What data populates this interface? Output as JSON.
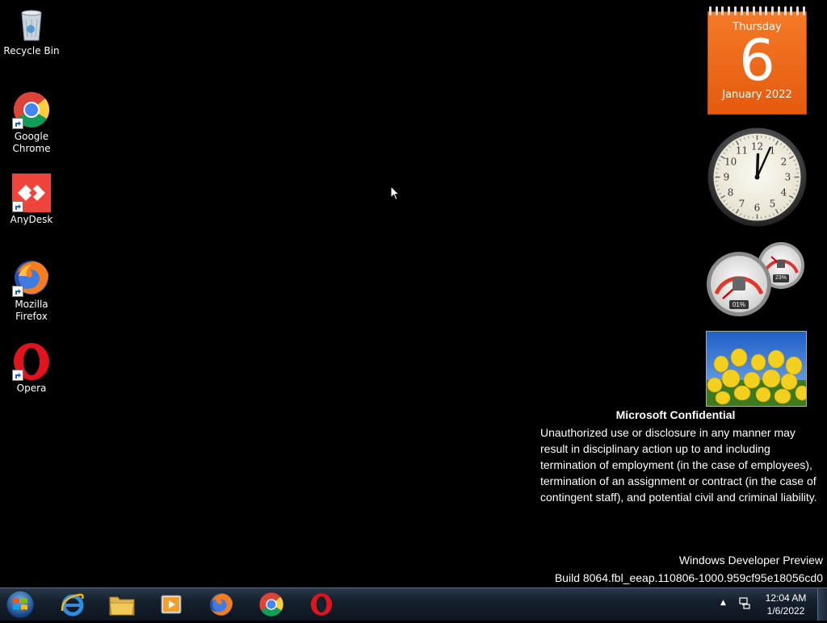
{
  "desktop": {
    "icons": [
      {
        "label_line1": "Recycle Bin",
        "label_line2": "",
        "icon": "recycle-bin-icon"
      },
      {
        "label_line1": "Google",
        "label_line2": "Chrome",
        "icon": "chrome-icon"
      },
      {
        "label_line1": "AnyDesk",
        "label_line2": "",
        "icon": "anydesk-icon"
      },
      {
        "label_line1": "Mozilla",
        "label_line2": "Firefox",
        "icon": "firefox-icon"
      },
      {
        "label_line1": "Opera",
        "label_line2": "",
        "icon": "opera-icon"
      }
    ]
  },
  "gadgets": {
    "calendar": {
      "weekday": "Thursday",
      "day": "6",
      "month_year": "January 2022",
      "color": "#f07020"
    },
    "clock": {
      "numbers": [
        "12",
        "1",
        "2",
        "3",
        "4",
        "5",
        "6",
        "7",
        "8",
        "9",
        "10",
        "11"
      ],
      "hour": 12,
      "minute": 4
    },
    "cpu_meter": {
      "cpu": "01%",
      "memory": "23%"
    },
    "slideshow": {
      "subject": "yellow tulips"
    }
  },
  "watermark": {
    "title": "Microsoft Confidential",
    "body": "Unauthorized use or disclosure in any manner may result in disciplinary action up to and including termination of employment (in the case of employees), termination of an assignment or contract (in the case of contingent staff), and potential civil and criminal liability.",
    "build_line1": "Windows Developer Preview",
    "build_line2": "Build 8064.fbl_eeap.110806-1000.959cf95e18056cd0"
  },
  "taskbar": {
    "pinned": [
      "start-orb",
      "internet-explorer",
      "file-explorer",
      "media-player",
      "firefox",
      "chrome",
      "opera"
    ],
    "tray": {
      "time": "12:04 AM",
      "date": "1/6/2022",
      "arrow": "▲"
    }
  }
}
